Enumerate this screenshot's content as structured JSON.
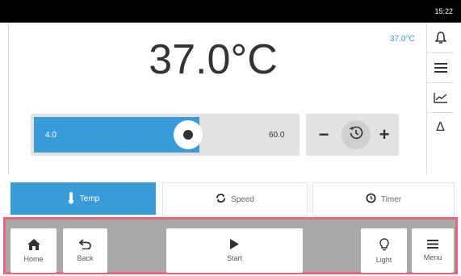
{
  "status_bar": {
    "time": "15:22"
  },
  "temperature": {
    "setpoint": "37.0°C",
    "current": "37.0°C"
  },
  "slider": {
    "min_label": "4.0",
    "max_label": "60.0",
    "level_fraction": 0.58
  },
  "stepper": {
    "minus": "−",
    "plus": "+"
  },
  "sidebar": {
    "icons": [
      "bell-icon",
      "list-icon",
      "chart-icon",
      "delta-icon"
    ],
    "delta_symbol": "Δ"
  },
  "tabs": [
    {
      "label": "Temp",
      "icon": "thermometer-icon",
      "active": true
    },
    {
      "label": "Speed",
      "icon": "refresh-icon",
      "active": false
    },
    {
      "label": "Timer",
      "icon": "clock-icon",
      "active": false
    }
  ],
  "bottom_nav": {
    "home": "Home",
    "back": "Back",
    "start": "Start",
    "light": "Light",
    "menu": "Menu"
  },
  "colors": {
    "accent": "#3a9bd9",
    "highlight_border": "#e7657a",
    "status_bar": "#000000"
  }
}
